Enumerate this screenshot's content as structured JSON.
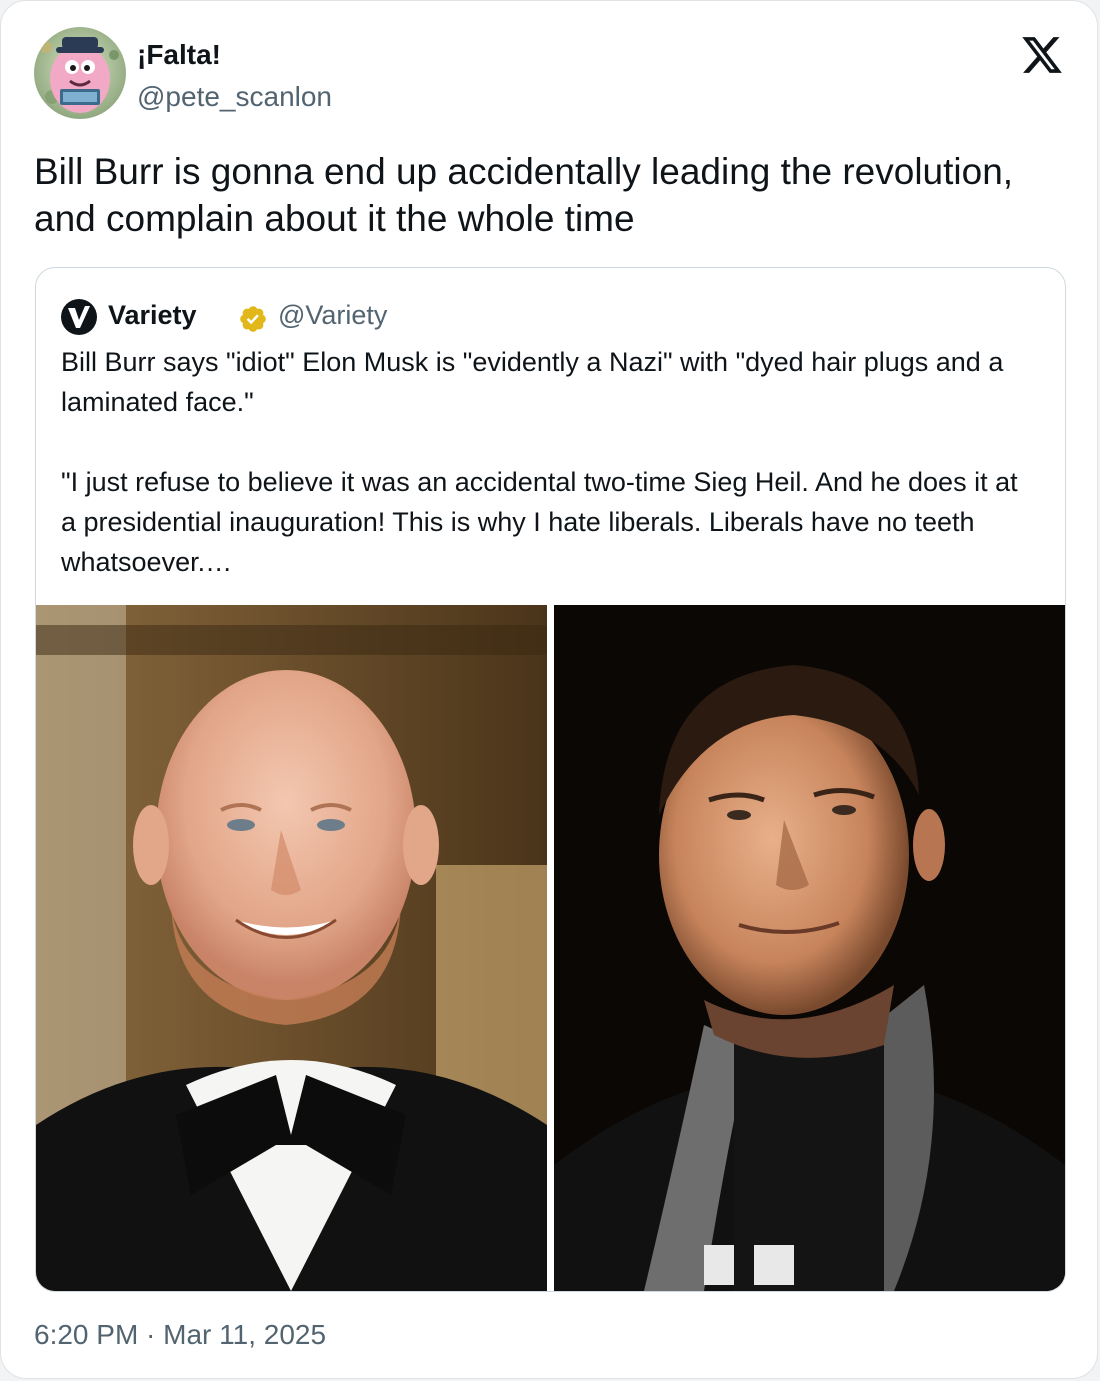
{
  "author": {
    "display_name": "¡Falta!",
    "handle": "@pete_scanlon"
  },
  "tweet": {
    "text": "Bill Burr is gonna end up accidentally leading the revolution, and complain about it the whole time"
  },
  "quoted_tweet": {
    "display_name": "Variety",
    "handle": "@Variety",
    "paragraph_1": "Bill Burr says \"idiot\" Elon Musk is \"evidently a Nazi\" with \"dyed hair plugs and a laminated face.\"",
    "paragraph_2": "\"I just refuse to believe it was an accidental two-time Sieg Heil. And he does it at a presidential inauguration! This is why I hate liberals. Liberals have no teeth whatsoever.…"
  },
  "timestamp": "6:20 PM · Mar 11, 2025",
  "icons": {
    "platform": "x-logo-icon",
    "verified": "gold-verified-badge-icon"
  },
  "colors": {
    "text_primary": "#0f1419",
    "text_secondary": "#536471",
    "border": "#cfd9de",
    "verified_gold": "#e2b719"
  }
}
